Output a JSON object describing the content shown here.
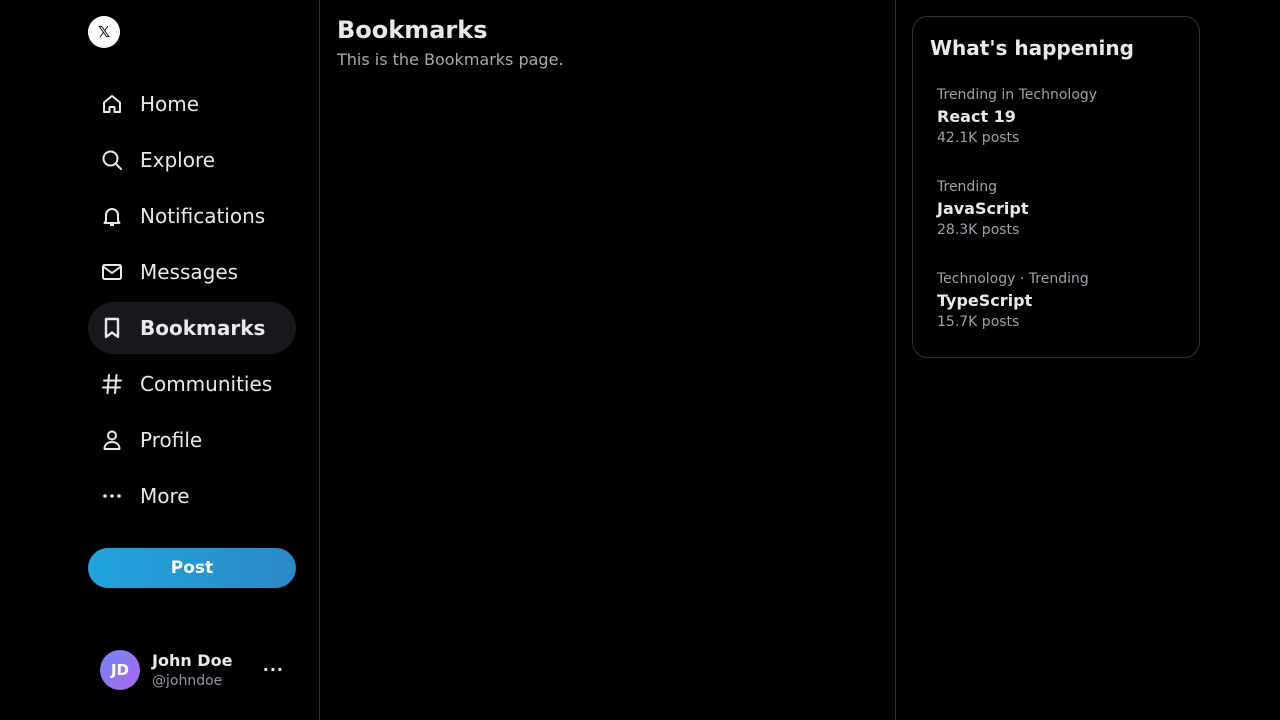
{
  "sidebar": {
    "logo": "𝕏",
    "nav": [
      {
        "label": "Home",
        "icon": "home-icon"
      },
      {
        "label": "Explore",
        "icon": "search-icon"
      },
      {
        "label": "Notifications",
        "icon": "bell-icon"
      },
      {
        "label": "Messages",
        "icon": "mail-icon"
      },
      {
        "label": "Bookmarks",
        "icon": "bookmark-icon",
        "active": true
      },
      {
        "label": "Communities",
        "icon": "hash-icon"
      },
      {
        "label": "Profile",
        "icon": "person-icon"
      },
      {
        "label": "More",
        "icon": "more-icon"
      }
    ],
    "post_label": "Post",
    "account": {
      "initials": "JD",
      "name": "John Doe",
      "handle": "@johndoe",
      "more": "···"
    }
  },
  "main": {
    "title": "Bookmarks",
    "subtitle": "This is the Bookmarks page."
  },
  "trends": {
    "title": "What's happening",
    "items": [
      {
        "context": "Trending in Technology",
        "name": "React 19",
        "count": "42.1K posts"
      },
      {
        "context": "Trending",
        "name": "JavaScript",
        "count": "28.3K posts"
      },
      {
        "context": "Technology · Trending",
        "name": "TypeScript",
        "count": "15.7K posts"
      }
    ]
  },
  "colors": {
    "background": "#000000",
    "text": "#e7e9ea",
    "muted": "#9aa3ab",
    "border": "#2f3336",
    "post_button": "#1d9bf0"
  }
}
